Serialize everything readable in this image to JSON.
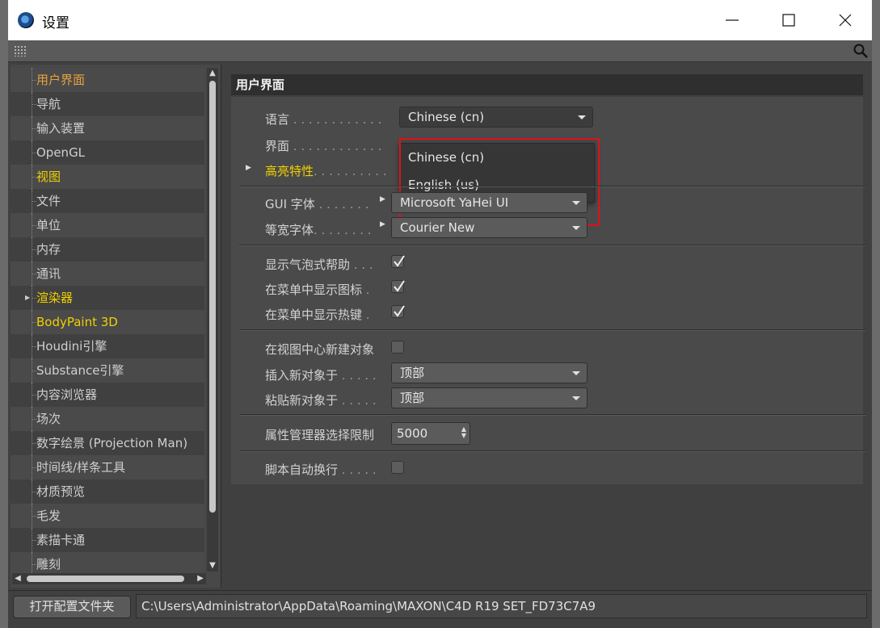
{
  "window": {
    "title": "设置",
    "controls": {
      "minimize": "—",
      "maximize": "☐",
      "close": "✕"
    }
  },
  "sidebar": {
    "items": [
      {
        "label": "用户界面",
        "state": "active"
      },
      {
        "label": "导航",
        "state": ""
      },
      {
        "label": "输入装置",
        "state": ""
      },
      {
        "label": "OpenGL",
        "state": ""
      },
      {
        "label": "视图",
        "state": "hl"
      },
      {
        "label": "文件",
        "state": ""
      },
      {
        "label": "单位",
        "state": ""
      },
      {
        "label": "内存",
        "state": ""
      },
      {
        "label": "通讯",
        "state": ""
      },
      {
        "label": "渲染器",
        "state": "hl",
        "expandable": true
      },
      {
        "label": "BodyPaint 3D",
        "state": "hl"
      },
      {
        "label": "Houdini引擎",
        "state": ""
      },
      {
        "label": "Substance引擎",
        "state": ""
      },
      {
        "label": "内容浏览器",
        "state": ""
      },
      {
        "label": "场次",
        "state": ""
      },
      {
        "label": "数字绘景 (Projection Man)",
        "state": ""
      },
      {
        "label": "时间线/样条工具",
        "state": ""
      },
      {
        "label": "材质预览",
        "state": ""
      },
      {
        "label": "毛发",
        "state": ""
      },
      {
        "label": "素描卡通",
        "state": ""
      },
      {
        "label": "雕刻",
        "state": ""
      }
    ]
  },
  "main": {
    "section_title": "用户界面",
    "language": {
      "label": "语言",
      "dots": " . . . . . . . . . . . .",
      "value": "Chinese (cn)"
    },
    "interface": {
      "label": "界面",
      "dots": " . . . . . . . . . . . ."
    },
    "highlight": {
      "label": "高亮特性",
      "dots": ". . . . . . . . . ."
    },
    "language_options": [
      "Chinese (cn)",
      "English (us)"
    ],
    "gui_font": {
      "label": "GUI 字体",
      "dots": " . . . . . . .",
      "value": "Microsoft YaHei UI"
    },
    "mono_font": {
      "label": "等宽字体",
      "dots": ". . . . . . . .",
      "value": "Courier New"
    },
    "bubble_help": {
      "label": "显示气泡式帮助",
      "dots": " . . .",
      "checked": true
    },
    "menu_icons": {
      "label": "在菜单中显示图标",
      "dots": " .",
      "checked": true
    },
    "menu_hotkeys": {
      "label": "在菜单中显示热键",
      "dots": " .",
      "checked": true
    },
    "new_obj_center": {
      "label": "在视图中心新建对象",
      "checked": false
    },
    "insert_new": {
      "label": "插入新对象于",
      "dots": " . . . . .",
      "value": "顶部"
    },
    "paste_new": {
      "label": "粘贴新对象于",
      "dots": " . . . . .",
      "value": "顶部"
    },
    "attr_limit": {
      "label": "属性管理器选择限制",
      "value": "5000"
    },
    "script_wrap": {
      "label": "脚本自动换行",
      "dots": " . . . . .",
      "checked": false
    }
  },
  "footer": {
    "open_folder_label": "打开配置文件夹",
    "path": "C:\\Users\\Administrator\\AppData\\Roaming\\MAXON\\C4D R19 SET_FD73C7A9"
  },
  "colors": {
    "active": "#e8a43b",
    "highlight": "#f0d000",
    "annotation": "#e0101a"
  }
}
